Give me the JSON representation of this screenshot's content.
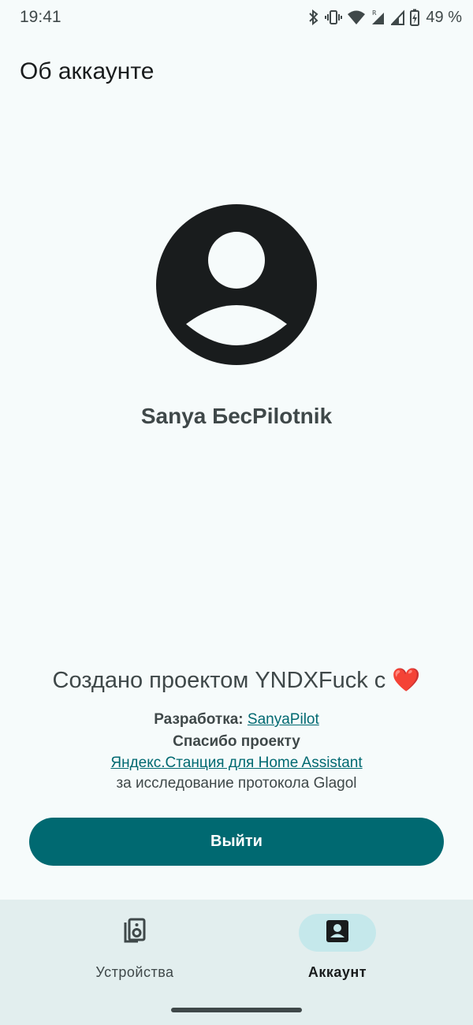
{
  "status_bar": {
    "time": "19:41",
    "battery_percent": "49 %",
    "icons": [
      "bluetooth-icon",
      "vibrate-icon",
      "wifi-icon",
      "signal-roaming-icon",
      "signal-icon",
      "battery-charging-icon"
    ]
  },
  "header": {
    "title": "Об аккаунте"
  },
  "profile": {
    "avatar_icon": "account-circle-icon",
    "name": "Sanya БесPilotnik"
  },
  "credits": {
    "title": "Создано проектом YNDXFuck с ❤️",
    "dev_label": "Разработка:",
    "dev_link": "SanyaPilot",
    "thanks_label": "Спасибо проекту",
    "thanks_link": "Яндекс.Станция для Home Assistant",
    "thanks_reason": "за исследование протокола Glagol"
  },
  "actions": {
    "logout_label": "Выйти"
  },
  "bottom_nav": {
    "items": [
      {
        "label": "Устройства",
        "icon": "speaker-devices-icon",
        "selected": false
      },
      {
        "label": "Аккаунт",
        "icon": "account-box-icon",
        "selected": true
      }
    ]
  },
  "colors": {
    "primary": "#006971",
    "background": "#f6fbfb",
    "nav_background": "#e2eeee",
    "nav_selected_pill": "#c5e8eb",
    "avatar": "#191c1d"
  }
}
